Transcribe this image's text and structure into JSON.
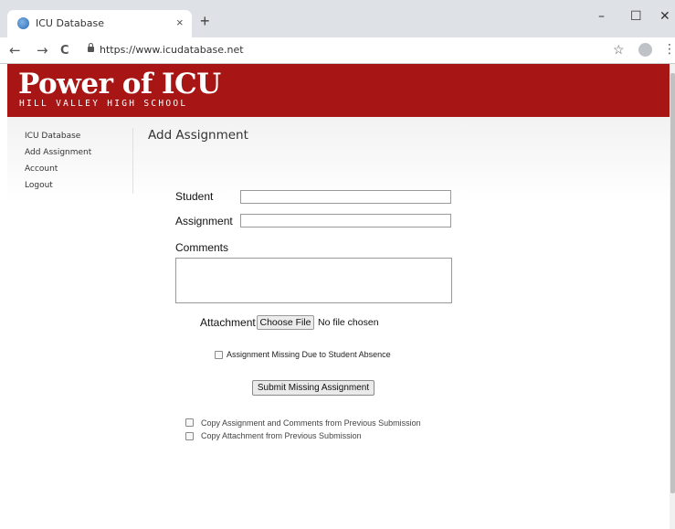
{
  "browser": {
    "tab_title": "ICU Database",
    "tab_close": "×",
    "new_tab": "+",
    "url": "https://www.icudatabase.net",
    "controls": {
      "minimize": "–",
      "maximize": "☐",
      "close": "✕"
    },
    "nav": {
      "back": "←",
      "forward": "→",
      "reload": "C"
    },
    "star": "☆",
    "menu": "⋮"
  },
  "site": {
    "brand": "Power of ICU",
    "subbrand": "HILL VALLEY HIGH SCHOOL",
    "banner_color": "#a81515"
  },
  "sidebar": {
    "items": [
      {
        "label": "ICU Database"
      },
      {
        "label": "Add Assignment"
      },
      {
        "label": "Account"
      },
      {
        "label": "Logout"
      }
    ]
  },
  "page": {
    "title": "Add Assignment"
  },
  "form": {
    "student_label": "Student",
    "student_value": "",
    "assignment_label": "Assignment",
    "assignment_value": "",
    "comments_label": "Comments",
    "attachment_label": "Attachment",
    "choose_file_label": "Choose File",
    "no_file_text": "No file chosen",
    "absence_checkbox_label": "Assignment Missing Due to Student Absence",
    "submit_label": "Submit Missing Assignment",
    "copy_comments_label": "Copy Assignment and Comments from Previous Submission",
    "copy_attachment_label": "Copy Attachment from Previous Submission"
  }
}
